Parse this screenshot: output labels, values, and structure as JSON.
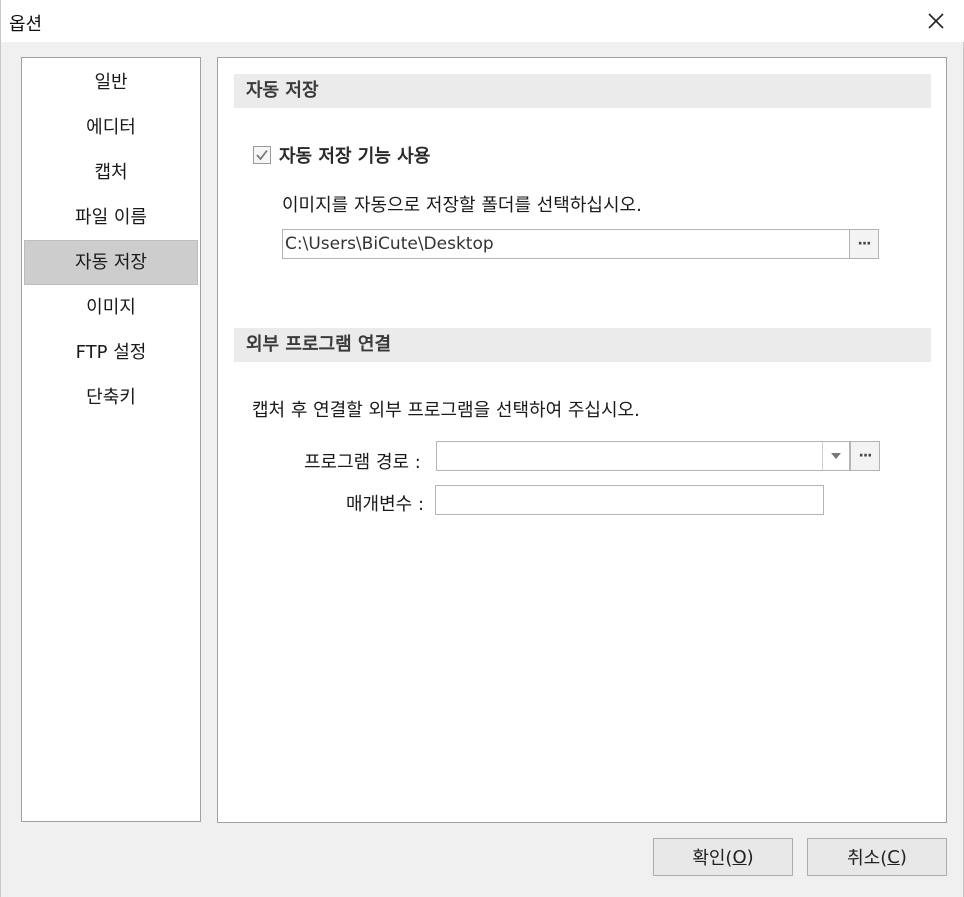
{
  "window": {
    "title": "옵션",
    "close_icon": "close-icon"
  },
  "nav": {
    "items": [
      {
        "label": "일반",
        "selected": false
      },
      {
        "label": "에디터",
        "selected": false
      },
      {
        "label": "캡처",
        "selected": false
      },
      {
        "label": "파일 이름",
        "selected": false
      },
      {
        "label": "자동 저장",
        "selected": true
      },
      {
        "label": "이미지",
        "selected": false
      },
      {
        "label": "FTP 설정",
        "selected": false
      },
      {
        "label": "단축키",
        "selected": false
      }
    ]
  },
  "autosave": {
    "header": "자동 저장",
    "enable_label": "자동 저장 기능 사용",
    "enable_checked": true,
    "folder_prompt": "이미지를 자동으로 저장할 폴더를 선택하십시오.",
    "folder_value": "C:\\Users\\BiCute\\Desktop",
    "browse_label": "···"
  },
  "external": {
    "header": "외부 프로그램 연결",
    "prompt": "캡처 후 연결할 외부 프로그램을 선택하여 주십시오.",
    "program_path_label": "프로그램 경로 :",
    "program_path_value": "",
    "browse_label": "···",
    "params_label": "매개변수 :",
    "params_value": ""
  },
  "footer": {
    "ok_prefix": "확인(",
    "ok_key": "O",
    "ok_suffix": ")",
    "cancel_prefix": "취소(",
    "cancel_key": "C",
    "cancel_suffix": ")"
  }
}
